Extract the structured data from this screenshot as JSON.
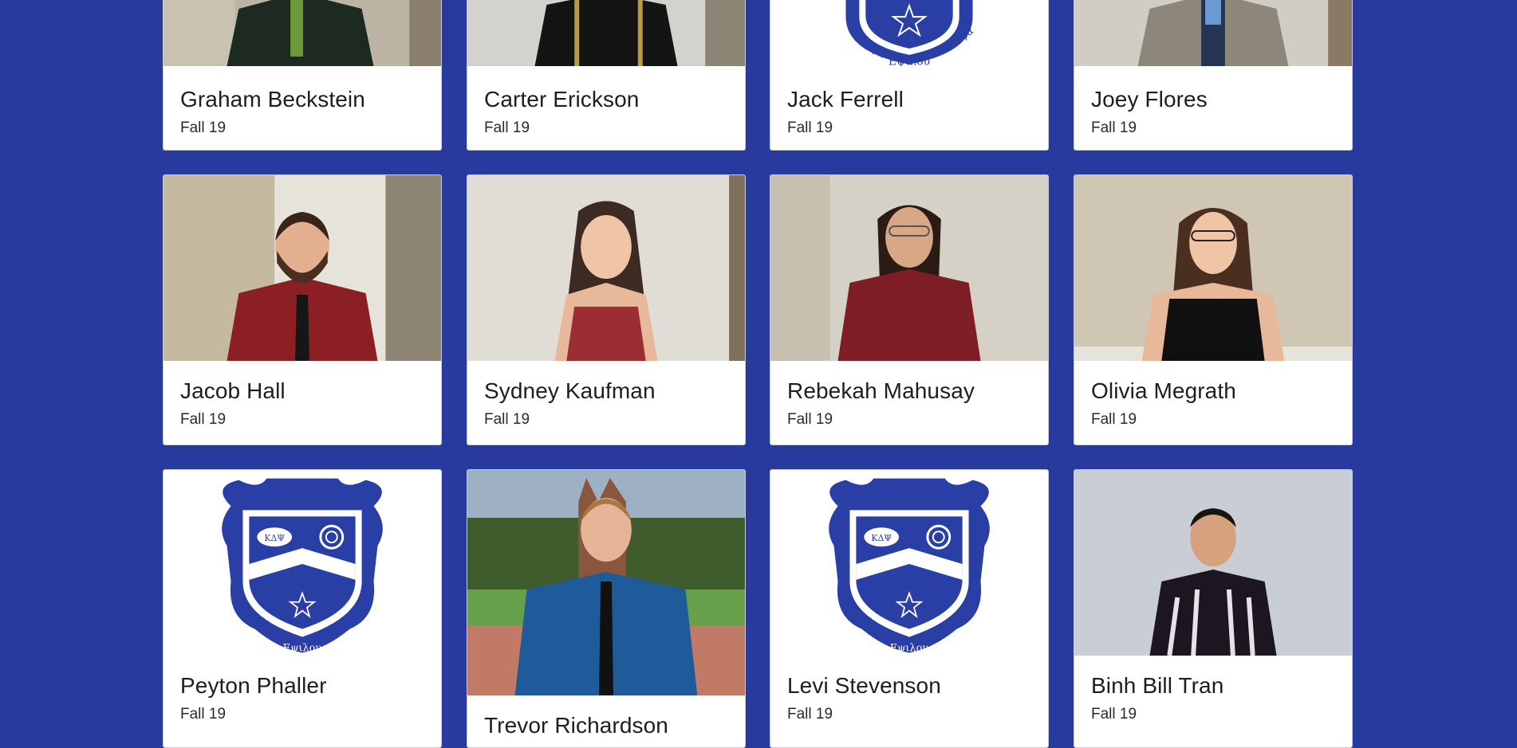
{
  "cards": [
    {
      "name": "Graham Beckstein",
      "term": "Fall 19",
      "photo": "portrait-photo"
    },
    {
      "name": "Carter Erickson",
      "term": "Fall 19",
      "photo": "portrait-photo"
    },
    {
      "name": "Jack Ferrell",
      "term": "Fall 19",
      "photo": "crest-icon"
    },
    {
      "name": "Joey Flores",
      "term": "Fall 19",
      "photo": "portrait-photo"
    },
    {
      "name": "Jacob Hall",
      "term": "Fall 19",
      "photo": "portrait-photo"
    },
    {
      "name": "Sydney Kaufman",
      "term": "Fall 19",
      "photo": "portrait-photo"
    },
    {
      "name": "Rebekah Mahusay",
      "term": "Fall 19",
      "photo": "portrait-photo"
    },
    {
      "name": "Olivia Megrath",
      "term": "Fall 19",
      "photo": "portrait-photo"
    },
    {
      "name": "Peyton Phaller",
      "term": "Fall 19",
      "photo": "crest-icon"
    },
    {
      "name": "Trevor Richardson",
      "term": "",
      "photo": "portrait-photo"
    },
    {
      "name": "Levi Stevenson",
      "term": "Fall 19",
      "photo": "crest-icon"
    },
    {
      "name": "Binh Bill Tran",
      "term": "Fall 19",
      "photo": "portrait-photo"
    }
  ],
  "crest": {
    "banner_letters": "ΚΔΨ",
    "motto_left": "Αλφα",
    "motto_bottom": "Εψιλου",
    "motto_right": "Αλφα"
  },
  "colors": {
    "background": "#283a9e",
    "crest_blue": "#2a3fa6",
    "card": "#ffffff"
  }
}
